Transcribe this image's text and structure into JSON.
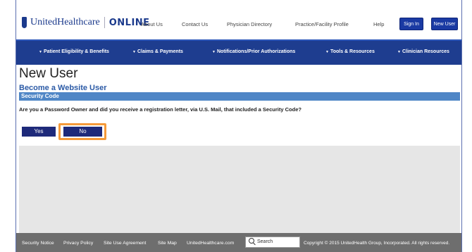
{
  "header": {
    "logo_text": "UnitedHealthcare",
    "logo_online": "ONLINE",
    "links": [
      "About Us",
      "Contact Us",
      "Physician Directory",
      "Practice/Facility Profile",
      "Help"
    ],
    "sign_in": "Sign In",
    "new_user": "New User"
  },
  "nav": {
    "items": [
      "Patient Eligibility & Benefits",
      "Claims & Payments",
      "Notifications/Prior Authorizations",
      "Tools & Resources",
      "Clinician Resources"
    ]
  },
  "main": {
    "page_title": "New User",
    "section_heading": "Become a Website User",
    "section_bar": "Security Code",
    "question": "Are you a Password Owner and did you receive a registration letter, via U.S. Mail, that included a Security Code?",
    "yes_label": "Yes",
    "no_label": "No"
  },
  "footer": {
    "links": [
      "Security Notice",
      "Privacy Policy",
      "Site Use Agreement",
      "Site Map",
      "UnitedHealthcare.com"
    ],
    "search_placeholder": "Search",
    "copyright": "Copyright © 2015 UnitedHealth Group, Incorporated. All rights reserved."
  },
  "colors": {
    "brand_blue": "#1e3d8f",
    "section_bar": "#4f86c6",
    "highlight": "#f59a3a",
    "footer": "#6e6e6e"
  }
}
